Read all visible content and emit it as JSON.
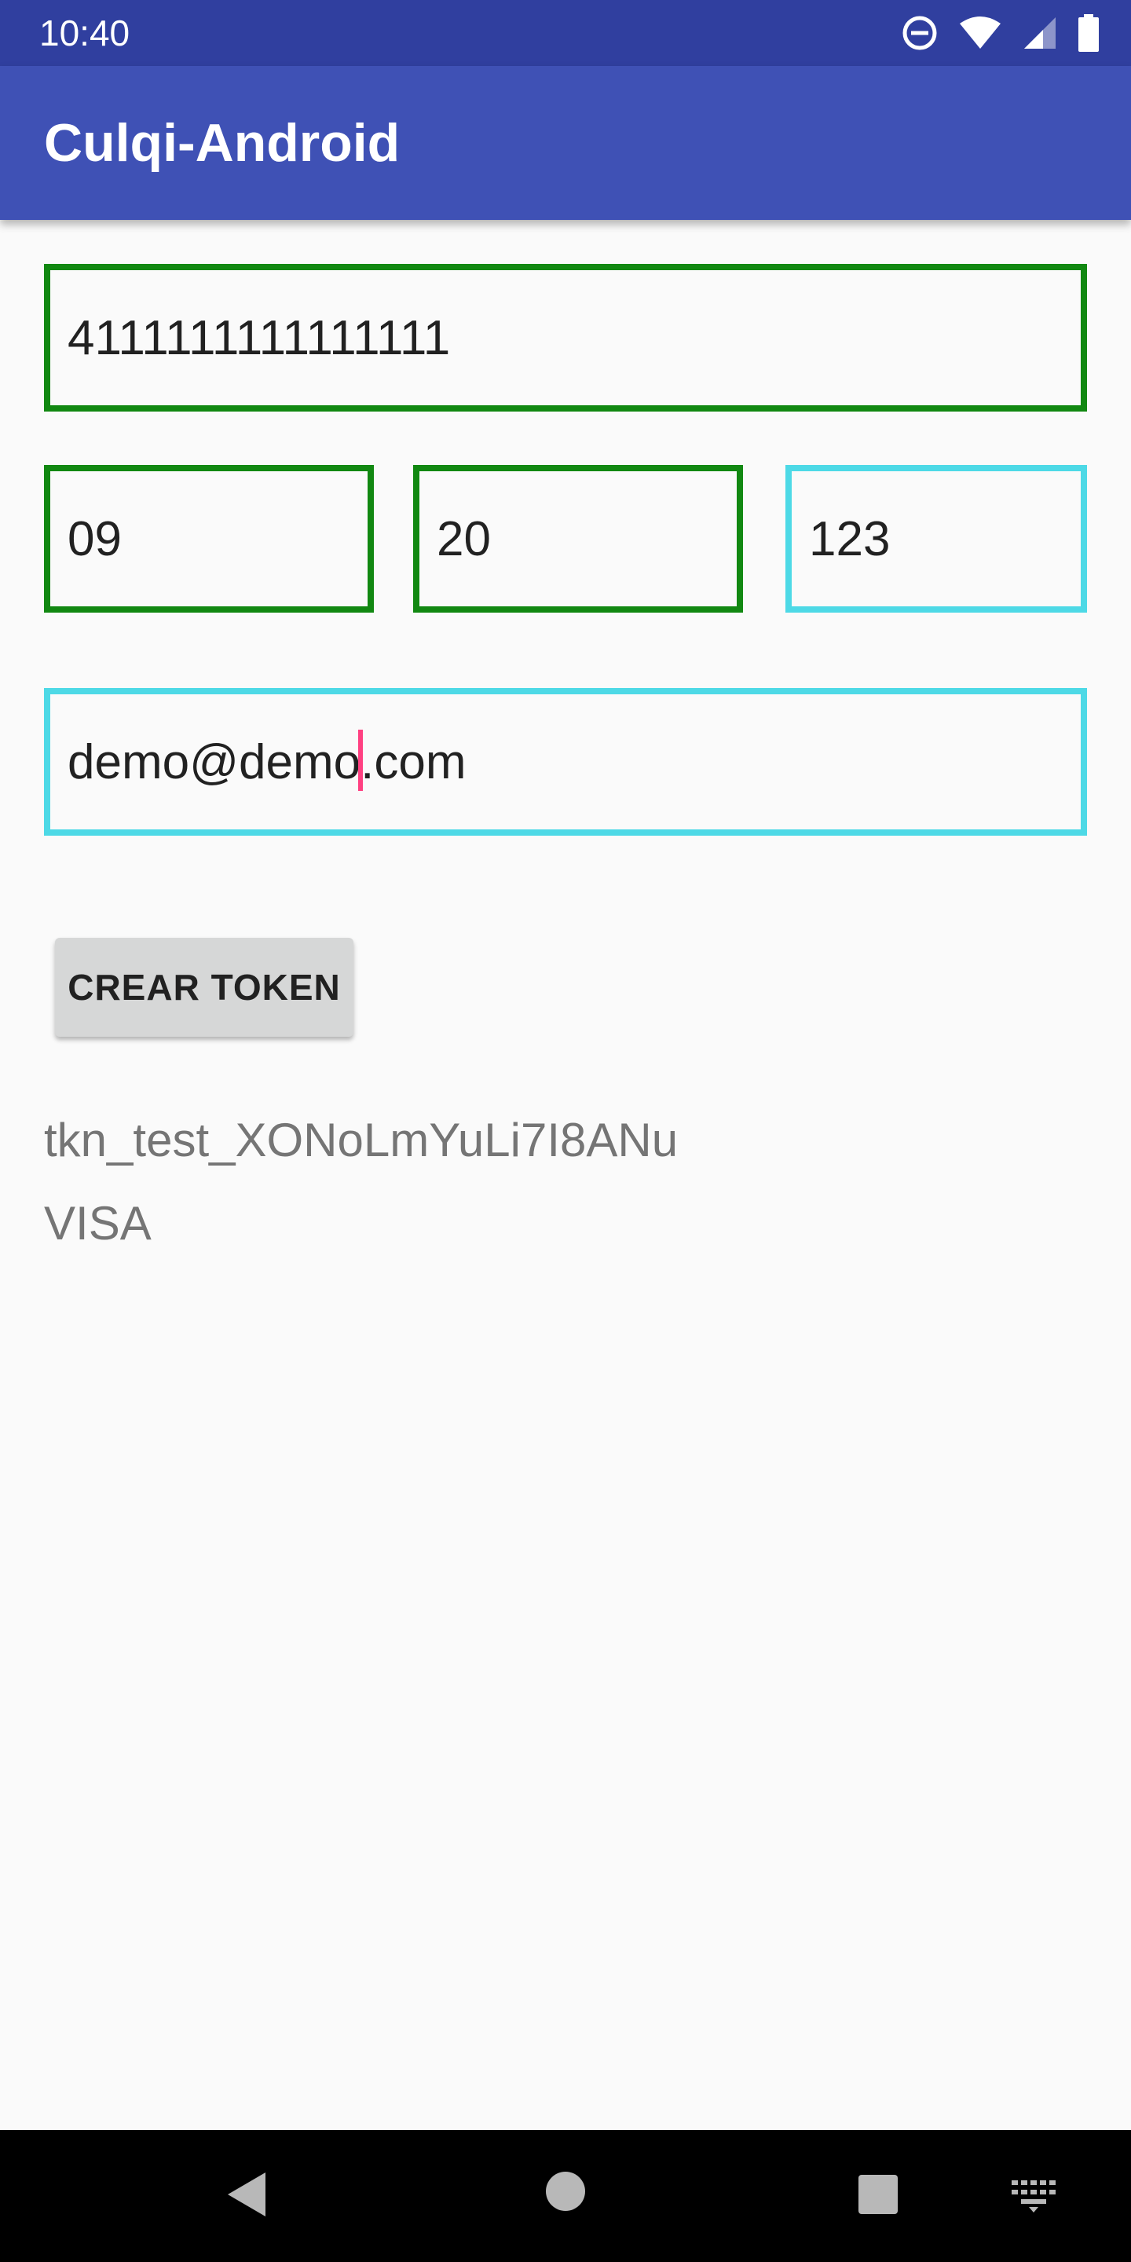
{
  "status_bar": {
    "time": "10:40",
    "icons": [
      "do-not-disturb-icon",
      "wifi-icon",
      "signal-icon",
      "battery-icon"
    ]
  },
  "app_bar": {
    "title": "Culqi-Android",
    "color": "#3f51b5",
    "status_color": "#303f9f"
  },
  "form": {
    "card_number": "4111111111111111",
    "exp_month": "09",
    "exp_year": "20",
    "cvv": "123",
    "email_before_cursor": "demo@demo",
    "email_after_cursor": ".com",
    "valid_border_color": "#118811",
    "focus_border_color": "#4dd9e6",
    "cursor_color": "#ff4081"
  },
  "button": {
    "label": "CREAR TOKEN"
  },
  "result": {
    "token": "tkn_test_XONoLmYuLi7I8ANu",
    "brand": "VISA"
  },
  "nav_bar": {
    "icons": [
      "back-icon",
      "home-icon",
      "recents-icon",
      "keyboard-icon"
    ]
  }
}
